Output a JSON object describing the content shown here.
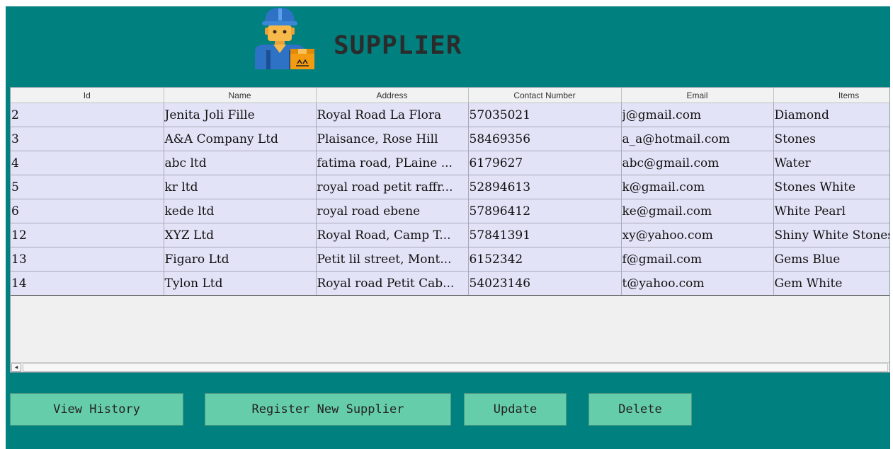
{
  "header": {
    "title": "SUPPLIER",
    "logo_icon": "supplier-worker-with-box-icon"
  },
  "table": {
    "columns": [
      "Id",
      "Name",
      "Address",
      "Contact Number",
      "Email",
      "Items"
    ],
    "rows": [
      [
        "2",
        "Jenita Joli Fille",
        "Royal Road La Flora",
        "57035021",
        "j@gmail.com",
        "Diamond"
      ],
      [
        "3",
        "A&A Company Ltd",
        "Plaisance, Rose Hill",
        "58469356",
        "a_a@hotmail.com",
        "Stones"
      ],
      [
        "4",
        "abc ltd",
        "fatima road, PLaine ...",
        "6179627",
        "abc@gmail.com",
        "Water"
      ],
      [
        "5",
        "kr ltd",
        "royal road petit raffr...",
        "52894613",
        "k@gmail.com",
        "Stones White"
      ],
      [
        "6",
        "kede ltd",
        "royal road ebene",
        "57896412",
        "ke@gmail.com",
        "White Pearl"
      ],
      [
        "12",
        "XYZ Ltd",
        "Royal Road, Camp T...",
        "57841391",
        "xy@yahoo.com",
        "Shiny White Stones"
      ],
      [
        "13",
        "Figaro Ltd",
        "Petit lil street, Mont...",
        "6152342",
        "f@gmail.com",
        "Gems Blue"
      ],
      [
        "14",
        "Tylon Ltd",
        "Royal road Petit Cab...",
        "54023146",
        "t@yahoo.com",
        "Gem White"
      ]
    ]
  },
  "scrollbar": {
    "left_arrow": "◂"
  },
  "buttons": {
    "view_history": "View History",
    "register": "Register New Supplier",
    "update": "Update",
    "delete": "Delete"
  },
  "colors": {
    "background": "#00807f",
    "button": "#66cdaa",
    "row": "#e3e3f7"
  }
}
